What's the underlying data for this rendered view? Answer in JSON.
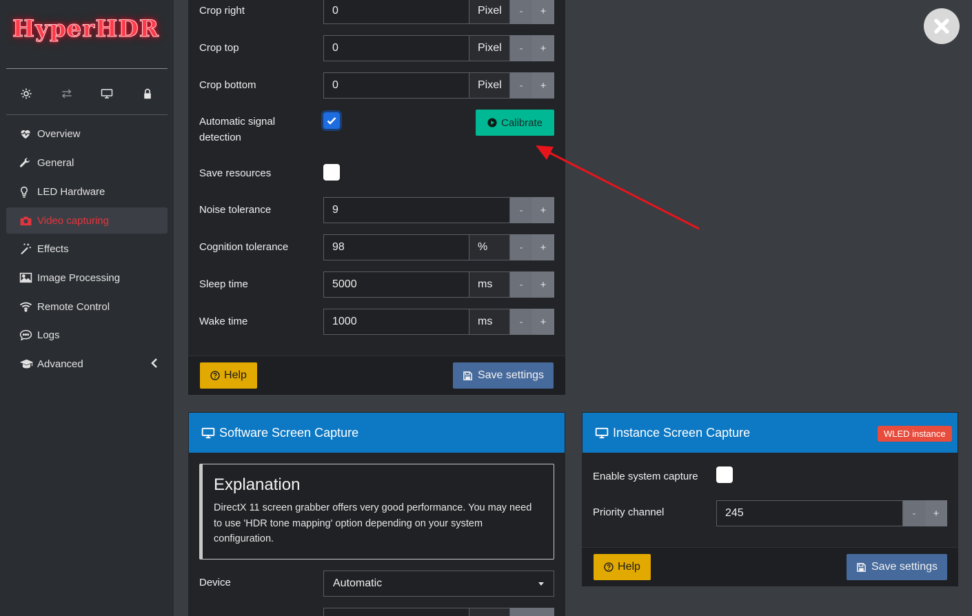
{
  "brand": {
    "logo_text": "HyperHDR"
  },
  "quick_icons": [
    "gear-icon",
    "transfer-icon",
    "monitor-icon",
    "lock-icon"
  ],
  "sidebar": {
    "items": [
      {
        "label": "Overview",
        "icon": "heartbeat-icon"
      },
      {
        "label": "General",
        "icon": "wrench-icon"
      },
      {
        "label": "LED Hardware",
        "icon": "lightbulb-icon"
      },
      {
        "label": "Video capturing",
        "icon": "camera-icon",
        "active": true
      },
      {
        "label": "Effects",
        "icon": "magic-wand-icon"
      },
      {
        "label": "Image Processing",
        "icon": "image-icon"
      },
      {
        "label": "Remote Control",
        "icon": "wifi-icon"
      },
      {
        "label": "Logs",
        "icon": "chat-icon"
      },
      {
        "label": "Advanced",
        "icon": "graduation-cap-icon",
        "chevron": "<"
      }
    ]
  },
  "capture_settings": {
    "crop_right": {
      "label": "Crop right",
      "value": "0",
      "unit": "Pixel"
    },
    "crop_top": {
      "label": "Crop top",
      "value": "0",
      "unit": "Pixel"
    },
    "crop_bottom": {
      "label": "Crop bottom",
      "value": "0",
      "unit": "Pixel"
    },
    "auto_signal": {
      "label_line1": "Automatic signal",
      "label_line2": "detection",
      "checked": true
    },
    "calibrate_label": "Calibrate",
    "save_resources": {
      "label": "Save resources",
      "checked": false
    },
    "noise_tolerance": {
      "label": "Noise tolerance",
      "value": "9"
    },
    "cognition_tolerance": {
      "label": "Cognition tolerance",
      "value": "98",
      "unit": "%"
    },
    "sleep_time": {
      "label": "Sleep time",
      "value": "5000",
      "unit": "ms"
    },
    "wake_time": {
      "label": "Wake time",
      "value": "1000",
      "unit": "ms"
    },
    "minus": "-",
    "plus": "+",
    "help_label": "Help",
    "save_label": "Save settings"
  },
  "software_capture": {
    "title": "Software Screen Capture",
    "explanation_title": "Explanation",
    "explanation_text": "DirectX 11 screen grabber offers very good performance. You may need to use 'HDR tone mapping' option depending on your system configuration.",
    "device_label": "Device",
    "device_value": "Automatic"
  },
  "instance_capture": {
    "title": "Instance Screen Capture",
    "badge": "WLED instance",
    "enable_label": "Enable system capture",
    "enable_checked": false,
    "priority_label": "Priority channel",
    "priority_value": "245",
    "help_label": "Help",
    "save_label": "Save settings"
  },
  "colors": {
    "accent_red": "#e4353f",
    "header_blue": "#0d78c3",
    "calibrate_green": "#00b894",
    "help_yellow": "#e2a900",
    "save_blue": "#476a9c",
    "badge_red": "#e74c3c",
    "annotation_arrow": "#e8141c"
  }
}
